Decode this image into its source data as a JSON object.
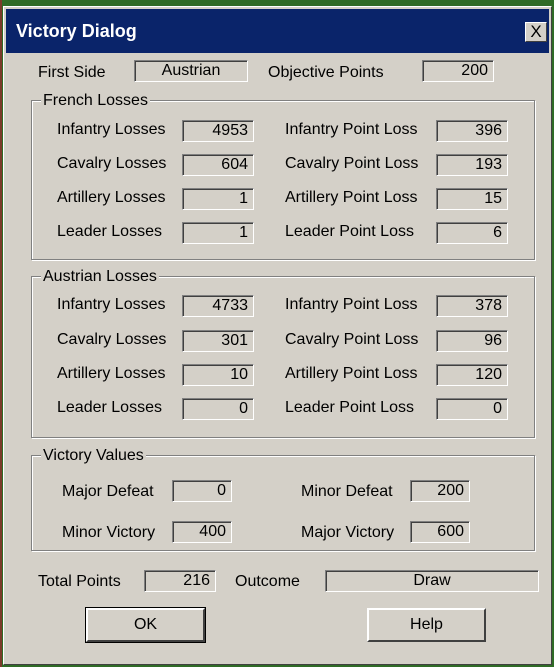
{
  "window": {
    "title": "Victory Dialog",
    "close_glyph": "X"
  },
  "header": {
    "first_side_label": "First Side",
    "first_side_value": "Austrian",
    "objective_points_label": "Objective Points",
    "objective_points_value": "200"
  },
  "french": {
    "title": "French Losses",
    "rows": [
      {
        "loss_label": "Infantry Losses",
        "loss_value": "4953",
        "point_label": "Infantry Point Loss",
        "point_value": "396"
      },
      {
        "loss_label": "Cavalry Losses",
        "loss_value": "604",
        "point_label": "Cavalry Point Loss",
        "point_value": "193"
      },
      {
        "loss_label": "Artillery Losses",
        "loss_value": "1",
        "point_label": "Artillery Point Loss",
        "point_value": "15"
      },
      {
        "loss_label": "Leader Losses",
        "loss_value": "1",
        "point_label": "Leader Point Loss",
        "point_value": "6"
      }
    ]
  },
  "austrian": {
    "title": "Austrian Losses",
    "rows": [
      {
        "loss_label": "Infantry Losses",
        "loss_value": "4733",
        "point_label": "Infantry Point Loss",
        "point_value": "378"
      },
      {
        "loss_label": "Cavalry Losses",
        "loss_value": "301",
        "point_label": "Cavalry Point Loss",
        "point_value": "96"
      },
      {
        "loss_label": "Artillery Losses",
        "loss_value": "10",
        "point_label": "Artillery Point Loss",
        "point_value": "120"
      },
      {
        "loss_label": "Leader Losses",
        "loss_value": "0",
        "point_label": "Leader Point Loss",
        "point_value": "0"
      }
    ]
  },
  "victory": {
    "title": "Victory Values",
    "major_defeat_label": "Major Defeat",
    "major_defeat_value": "0",
    "minor_defeat_label": "Minor Defeat",
    "minor_defeat_value": "200",
    "minor_victory_label": "Minor Victory",
    "minor_victory_value": "400",
    "major_victory_label": "Major Victory",
    "major_victory_value": "600"
  },
  "footer": {
    "total_points_label": "Total Points",
    "total_points_value": "216",
    "outcome_label": "Outcome",
    "outcome_value": "Draw",
    "ok_label": "OK",
    "help_label": "Help"
  },
  "colors": {
    "titlebar": "#0a246a",
    "face": "#d4d0c8",
    "background": "#2f6b26"
  }
}
